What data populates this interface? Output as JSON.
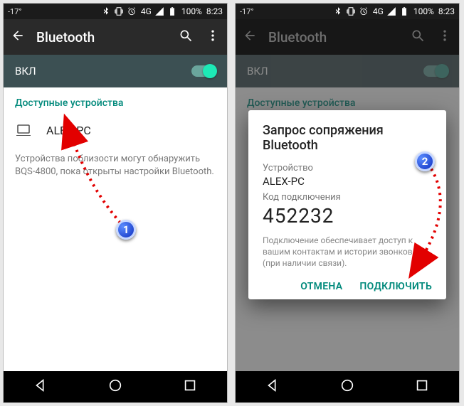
{
  "statusbar": {
    "temp": "-17°",
    "battery_pct": "100%",
    "time": "8:23",
    "net_label": "4G"
  },
  "appbar": {
    "title": "Bluetooth"
  },
  "toggle": {
    "on_label": "ВКЛ"
  },
  "section": {
    "available": "Доступные устройства"
  },
  "device": {
    "name": "ALEX-PC"
  },
  "hint": {
    "text": "Устройства поблизости могут обнаружить BQS-4800, пока открыты настройки Bluetooth."
  },
  "dialog": {
    "title": "Запрос сопряжения Bluetooth",
    "device_label": "Устройство",
    "device_name": "ALEX-PC",
    "code_label": "Код подключения",
    "code": "452232",
    "note": "Подключение обеспечивает доступ к вашим контактам и истории звонков (при наличии связи).",
    "cancel": "ОТМЕНА",
    "connect": "ПОДКЛЮЧИТЬ"
  },
  "annotation": {
    "badge1": "1",
    "badge2": "2"
  }
}
